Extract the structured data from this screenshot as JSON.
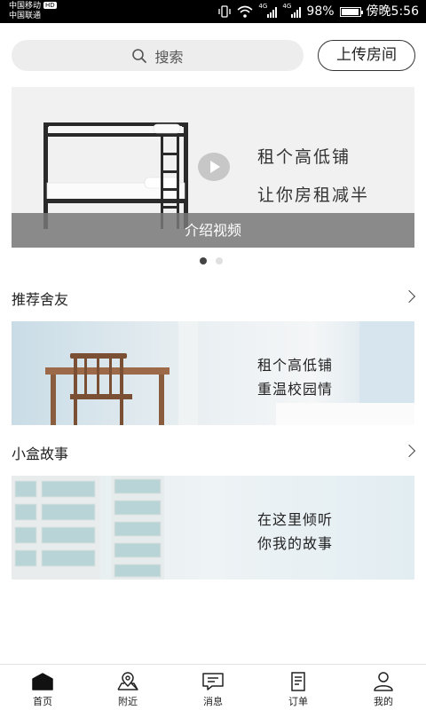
{
  "status_bar": {
    "carrier_1": "中国移动",
    "carrier_1_badge": "HD",
    "carrier_2": "中国联通",
    "net_1": "4G",
    "net_2": "4G",
    "battery": "98%",
    "battery_level": 0.98,
    "time": "傍晚5:56",
    "icons": [
      "vibrate-icon",
      "wifi-icon",
      "signal-icon",
      "signal-icon",
      "battery-icon"
    ]
  },
  "search": {
    "placeholder": "搜索",
    "icon": "search-icon"
  },
  "upload_button": "上传房间",
  "banner": {
    "line_1": "租个高低铺",
    "line_2": "让你房租减半",
    "caption": "介绍视频",
    "pages": 2,
    "active_page": 1
  },
  "section_roommates": {
    "title": "推荐舍友",
    "card_line_1": "租个高低铺",
    "card_line_2": "重温校园情"
  },
  "section_stories": {
    "title": "小盒故事",
    "card_line_1": "在这里倾听",
    "card_line_2": "你我的故事"
  },
  "tabbar": {
    "items": [
      {
        "label": "首页",
        "icon": "home-icon",
        "active": true
      },
      {
        "label": "附近",
        "icon": "location-icon",
        "active": false
      },
      {
        "label": "消息",
        "icon": "message-icon",
        "active": false
      },
      {
        "label": "订单",
        "icon": "order-icon",
        "active": false
      },
      {
        "label": "我的",
        "icon": "profile-icon",
        "active": false
      }
    ]
  },
  "colors": {
    "text": "#222222",
    "search_bg": "#ededed",
    "banner_bg": "#f1f1f1",
    "caption_bg": "#787878"
  }
}
